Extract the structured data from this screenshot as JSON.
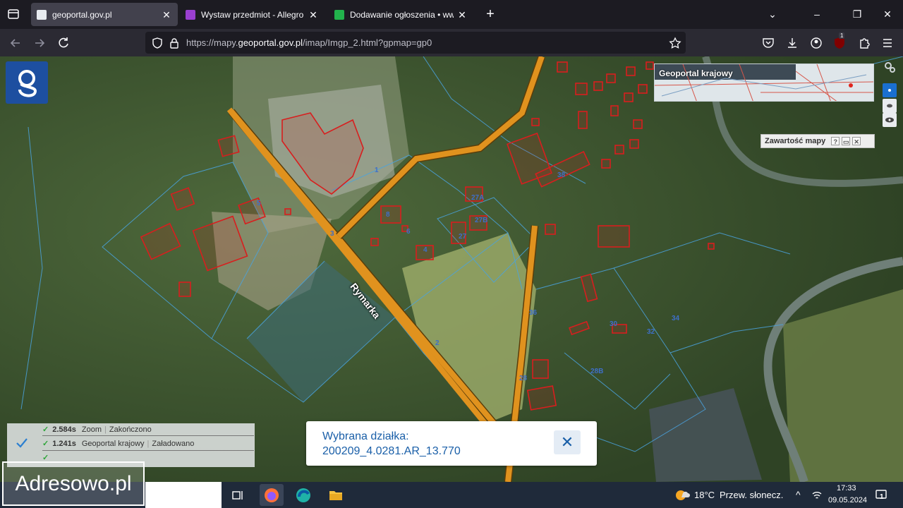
{
  "browser": {
    "tabs": [
      {
        "title": "geoportal.gov.pl",
        "active": true,
        "favicon_color": "#e8ebf0"
      },
      {
        "title": "Wystaw przedmiot - Allegro Lok",
        "active": false,
        "favicon_color": "#9a3fd0"
      },
      {
        "title": "Dodawanie ogłoszenia • www.o",
        "active": false,
        "favicon_color": "#22b24c"
      }
    ],
    "new_tab_label": "+",
    "window_controls": {
      "collapse": "⌄",
      "minimize": "–",
      "restore": "❐",
      "close": "✕"
    },
    "url_prefix": "https://mapy.",
    "url_domain": "geoportal.gov.pl",
    "url_suffix": "/imap/Imgp_2.html?gpmap=gp0",
    "extension_badge": "1"
  },
  "map": {
    "overview_label": "Geoportal krajowy",
    "content_panel": {
      "title": "Zawartość mapy",
      "help": "?",
      "minimize": "▭",
      "close": "✕"
    },
    "street_label": "Rymarka",
    "parcel_labels": [
      {
        "text": "1"
      },
      {
        "text": "3"
      },
      {
        "text": "5"
      },
      {
        "text": "6"
      },
      {
        "text": "8"
      },
      {
        "text": "4"
      },
      {
        "text": "27A"
      },
      {
        "text": "27B"
      },
      {
        "text": "27"
      },
      {
        "text": "38"
      },
      {
        "text": "36"
      },
      {
        "text": "2"
      },
      {
        "text": "30"
      },
      {
        "text": "32"
      },
      {
        "text": "34"
      },
      {
        "text": "28B"
      },
      {
        "text": "28"
      }
    ],
    "status_log": [
      {
        "time": "2.584s",
        "action": "Zoom",
        "state": "Zakończono"
      },
      {
        "time": "1.241s",
        "action": "Geoportal krajowy",
        "state": "Załadowano"
      }
    ],
    "popup": {
      "title": "Wybrana działka:",
      "value": "200209_4.0281.AR_13.770",
      "close_label": "✕"
    }
  },
  "watermark": "Adresowo.pl",
  "taskbar": {
    "weather_temp": "18°C",
    "weather_desc": "Przew. słonecz.",
    "time": "17:33",
    "date": "09.05.2024",
    "notification_count": "1",
    "tray_chevron": "^"
  },
  "colors": {
    "road": "#e0921e",
    "building_outline": "#d81e1e",
    "parcel_line": "#4aa3df",
    "popup_text": "#1a5fa8"
  }
}
